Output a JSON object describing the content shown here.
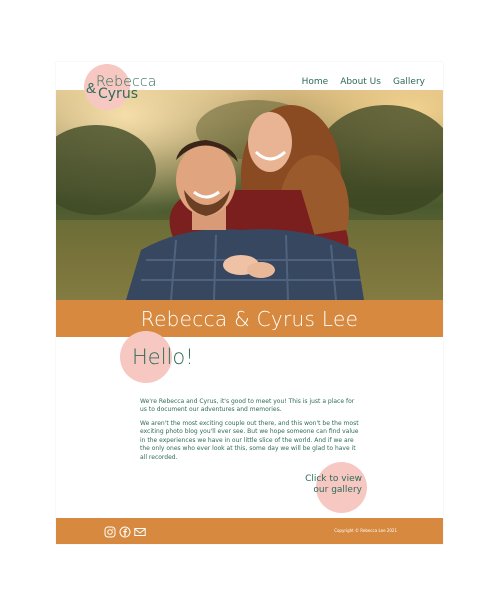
{
  "logo": {
    "line1": "Rebecca",
    "amp": "&",
    "line2": "Cyrus"
  },
  "nav": [
    {
      "label": "Home"
    },
    {
      "label": "About Us"
    },
    {
      "label": "Gallery"
    }
  ],
  "hero": {
    "image_subject": "couple-photo"
  },
  "banner": {
    "title": "Rebecca & Cyrus Lee"
  },
  "intro": {
    "heading": "Hello!",
    "paragraphs": [
      "We're Rebecca and Cyrus, it's good to meet you! This is just a place for us to document our adventures and memories.",
      "We aren't the most exciting couple out there, and this won't be the most exciting photo blog you'll ever see. But we hope someone can find value in the experiences we have in our little slice of the world. And if we are the only ones who ever look at this, some day we will be glad to have it all recorded."
    ]
  },
  "cta": {
    "label": "Click to view our gallery"
  },
  "footer": {
    "icons": [
      "instagram-icon",
      "facebook-icon",
      "mail-icon"
    ],
    "copyright": "Copyright © Rebecca Lee 2021"
  },
  "colors": {
    "accent": "#d6893f",
    "pink": "#f7c7c2",
    "green": "#2f6b59"
  }
}
